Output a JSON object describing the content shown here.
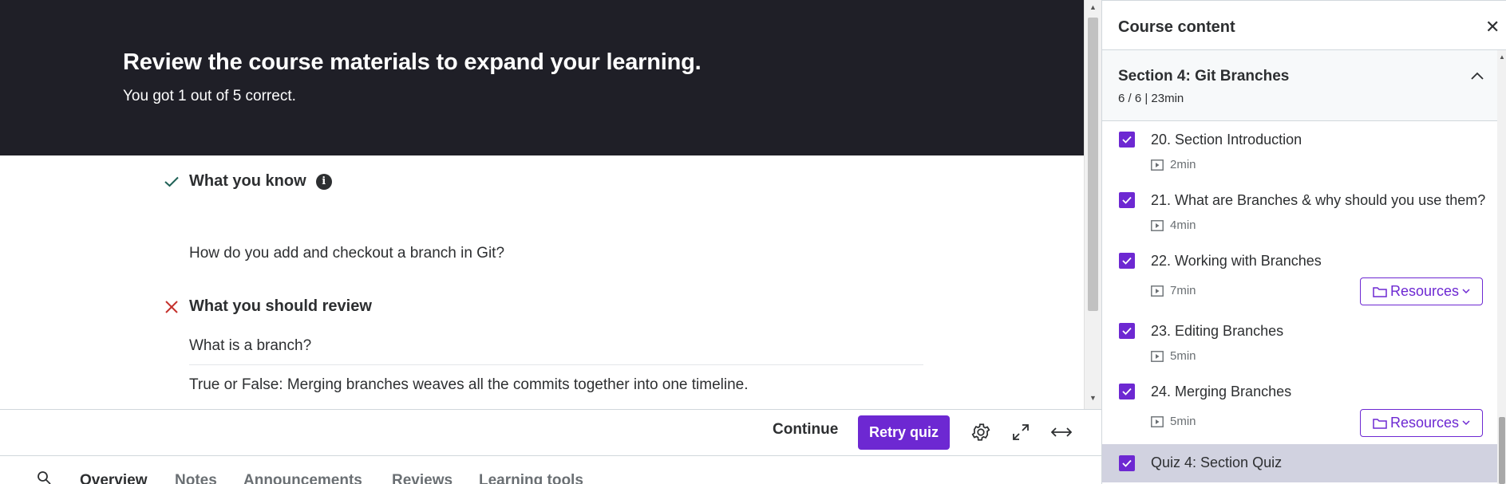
{
  "banner": {
    "heading": "Review the course materials to expand your learning.",
    "score": "You got 1 out of 5 correct."
  },
  "review": {
    "know_label": "What you know",
    "know_items": [
      "How do you add and checkout a branch in Git?"
    ],
    "should_review_label": "What you should review",
    "review_items": [
      "What is a branch?",
      "True or False: Merging branches weaves all the commits together into one timeline."
    ]
  },
  "controls": {
    "continue_label": "Continue",
    "retry_label": "Retry quiz"
  },
  "tabs": [
    {
      "label": "Overview",
      "active": true
    },
    {
      "label": "Notes",
      "active": false
    },
    {
      "label": "Announcements",
      "active": false
    },
    {
      "label": "Reviews",
      "active": false
    },
    {
      "label": "Learning tools",
      "active": false
    }
  ],
  "sidebar": {
    "title": "Course content",
    "section": {
      "title": "Section 4: Git Branches",
      "meta": "6 / 6 | 23min"
    },
    "items": [
      {
        "title": "20. Section Introduction",
        "duration": "2min",
        "completed": true
      },
      {
        "title": "21. What are Branches & why should you use them?",
        "duration": "4min",
        "completed": true
      },
      {
        "title": "22. Working with Branches",
        "duration": "7min",
        "completed": true,
        "resources_label": "Resources"
      },
      {
        "title": "23. Editing Branches",
        "duration": "5min",
        "completed": true
      },
      {
        "title": "24. Merging Branches",
        "duration": "5min",
        "completed": true,
        "resources_label": "Resources"
      },
      {
        "title": "Quiz 4: Section Quiz",
        "completed": true,
        "current": true
      }
    ]
  },
  "colors": {
    "accent": "#6d28d2",
    "banner_bg": "#1f1f27",
    "current_item_bg": "#d1d2e0",
    "correct": "#1e6055",
    "incorrect": "#c4302b"
  }
}
